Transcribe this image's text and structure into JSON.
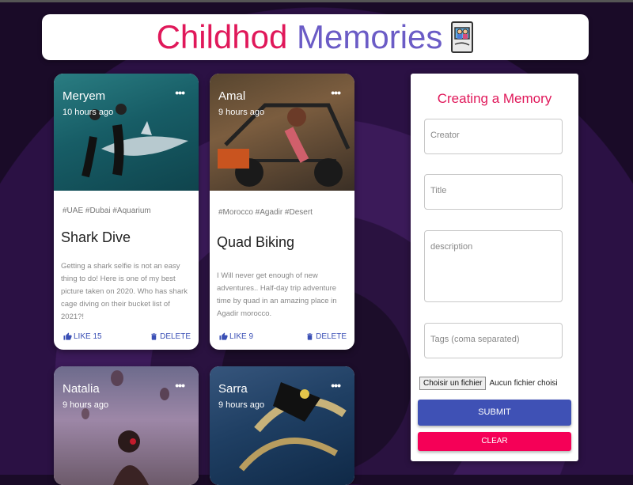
{
  "header": {
    "title_part1": "Childhod",
    "title_part2": "Memories"
  },
  "posts": [
    {
      "creator": "Meryem",
      "time": "10 hours ago",
      "tags": "#UAE #Dubai #Aquarium",
      "title": "Shark Dive",
      "description": "Getting a shark selfie is not an easy thing to do! Here is one of my best picture taken on 2020. Who has shark cage diving on their bucket list of 2021?!",
      "like": "LIKE 15",
      "delete": "DELETE",
      "more": "•••"
    },
    {
      "creator": "Amal",
      "time": "9 hours ago",
      "tags": "#Morocco #Agadir #Desert",
      "title": "Quad Biking",
      "description": "I Will never get enough of new adventures.. Half-day trip adventure time by quad in an amazing place in Agadir morocco.",
      "like": "LIKE 9",
      "delete": "DELETE",
      "more": "•••"
    },
    {
      "creator": "Natalia",
      "time": "9 hours ago",
      "more": "•••"
    },
    {
      "creator": "Sarra",
      "time": "9 hours ago",
      "more": "•••"
    }
  ],
  "form": {
    "heading": "Creating a Memory",
    "creator_placeholder": "Creator",
    "title_placeholder": "Title",
    "description_placeholder": "description",
    "tags_placeholder": "Tags (coma separated)",
    "file_button": "Choisir un fichier",
    "file_status": "Aucun fichier choisi",
    "submit": "SUBMIT",
    "clear": "CLEAR"
  },
  "colors": {
    "accent_pink": "#e0185a",
    "accent_purple": "#6b5cc6",
    "primary": "#3f51b5",
    "secondary": "#f50057"
  },
  "icons": [
    "photo-album-icon",
    "more-icon",
    "thumb-up-icon",
    "delete-icon"
  ]
}
